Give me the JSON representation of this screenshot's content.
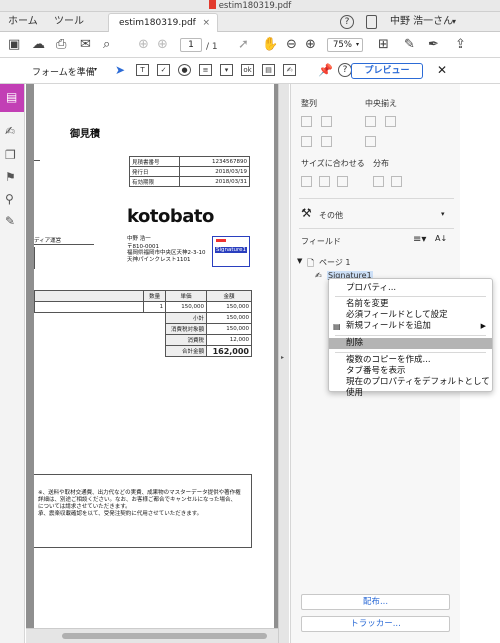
{
  "window": {
    "title": "estim180319.pdf"
  },
  "tabs": {
    "home": "ホーム",
    "tools": "ツール",
    "document": "estim180319.pdf",
    "close": "×"
  },
  "account": {
    "help": "?",
    "user": "中野 浩一さん",
    "dropdown": "▾"
  },
  "toolbar": {
    "page_current": "1",
    "page_total": "/ 1",
    "zoom": "75%"
  },
  "formbar": {
    "prepare_form": "フォームを準備",
    "preview": "プレビュー",
    "close": "✕"
  },
  "document": {
    "title": "御見積",
    "info_rows": [
      {
        "label": "見積書番号",
        "value": "1234567890"
      },
      {
        "label": "発行日",
        "value": "2018/03/19"
      },
      {
        "label": "有効期限",
        "value": "2018/03/31"
      }
    ],
    "brand": "kotobato",
    "sender_name": "中野 浩一",
    "sender_zip": "〒810-0001",
    "sender_addr1": "福岡県福岡市中央区天神2-3-10",
    "sender_addr2": "天神パインクレスト1101",
    "client_fragment": "ディア運営",
    "field_label": "Signature1",
    "items_header": {
      "qty": "数量",
      "unit": "単価",
      "amount": "金額"
    },
    "item_qty": "1",
    "item_unit": "150,000",
    "item_amount": "150,000",
    "totals": [
      {
        "label": "小計",
        "value": "150,000"
      },
      {
        "label": "消費税対象額",
        "value": "150,000"
      },
      {
        "label": "消費税",
        "value": "12,000"
      },
      {
        "label": "合計金額",
        "value": "162,000"
      }
    ],
    "notes": [
      "※、送料や取材交通費、出力代などの実費、成果物のマスターデータ提供や著作権",
      "詳細は、別途ご相談ください。なお、お客様ご都合でキャンセルになった場合、",
      "については請求させていただきます。",
      "承、震楽収載確認を以て、受発注契約に代用させていただきます。"
    ]
  },
  "panel": {
    "align": "整列",
    "center": "中央揃え",
    "size": "サイズに合わせる",
    "distribute": "分布",
    "other": "その他",
    "fields": "フィールド",
    "page_node": "ページ 1",
    "field_node": "Signature1",
    "distribute_btn": "配布...",
    "tracker_btn": "トラッカー..."
  },
  "context_menu": {
    "items": [
      "プロパティ...",
      "名前を変更",
      "必須フィールドとして設定",
      "新規フィールドを追加",
      "削除",
      "複数のコピーを作成...",
      "タブ番号を表示",
      "現在のプロパティをデフォルトとして使用"
    ],
    "submenu_arrow": "▶"
  },
  "colors": {
    "accent": "#2c6bd6",
    "rail_selected": "#c23fb5",
    "menu_highlight": "#b4b4b4",
    "field_border": "#2a3fbf"
  }
}
